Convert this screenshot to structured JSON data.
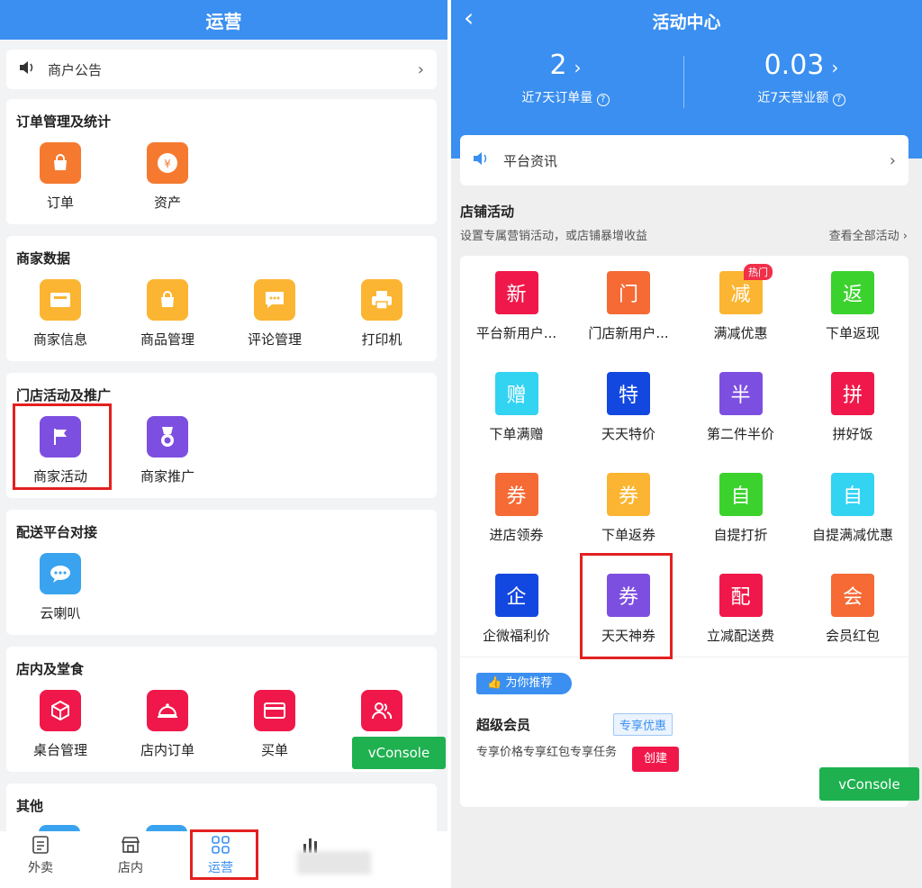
{
  "left": {
    "title": "运营",
    "notice": "商户公告",
    "sections": [
      {
        "title": "订单管理及统计",
        "items": [
          {
            "label": "订单",
            "icon": "bag-icon",
            "color": "#f57a30"
          },
          {
            "label": "资产",
            "icon": "yuan-coin-icon",
            "color": "#f57a30"
          }
        ]
      },
      {
        "title": "商家数据",
        "items": [
          {
            "label": "商家信息",
            "icon": "shop-info-icon",
            "color": "#fbb532"
          },
          {
            "label": "商品管理",
            "icon": "shopping-bag-icon",
            "color": "#fbb532"
          },
          {
            "label": "评论管理",
            "icon": "comment-icon",
            "color": "#fbb532"
          },
          {
            "label": "打印机",
            "icon": "printer-icon",
            "color": "#fbb532"
          }
        ]
      },
      {
        "title": "门店活动及推广",
        "items": [
          {
            "label": "商家活动",
            "icon": "flag-icon",
            "color": "#7d4fe0"
          },
          {
            "label": "商家推广",
            "icon": "medal-icon",
            "color": "#7d4fe0"
          }
        ]
      },
      {
        "title": "配送平台对接",
        "items": [
          {
            "label": "云喇叭",
            "icon": "chat-cloud-icon",
            "color": "#3aa3ef"
          }
        ]
      },
      {
        "title": "店内及堂食",
        "items": [
          {
            "label": "桌台管理",
            "icon": "cube-icon",
            "color": "#f0184a"
          },
          {
            "label": "店内订单",
            "icon": "bell-tray-icon",
            "color": "#f0184a"
          },
          {
            "label": "买单",
            "icon": "card-icon",
            "color": "#f0184a"
          },
          {
            "label": "",
            "icon": "users-icon",
            "color": "#f0184a"
          }
        ]
      },
      {
        "title": "其他",
        "items": []
      }
    ],
    "vconsole": "vConsole",
    "tabs": [
      {
        "label": "外卖",
        "icon": "list-icon"
      },
      {
        "label": "店内",
        "icon": "store-icon"
      },
      {
        "label": "运营",
        "icon": "grid-icon"
      },
      {
        "label": "",
        "icon": "bar-chart-icon"
      }
    ]
  },
  "right": {
    "title": "活动中心",
    "stats": [
      {
        "value": "2",
        "caption": "近7天订单量"
      },
      {
        "value": "0.03",
        "caption": "近7天营业额"
      }
    ],
    "notice": "平台资讯",
    "section_title": "店铺活动",
    "section_sub": "设置专属营销活动，或店铺暴增收益",
    "view_all": "查看全部活动",
    "activities": [
      {
        "char": "新",
        "label": "平台新用户...",
        "color": "#f0184a"
      },
      {
        "char": "门",
        "label": "门店新用户...",
        "color": "#f56a35"
      },
      {
        "char": "减",
        "label": "满减优惠",
        "color": "#fbb532",
        "badge": "热门"
      },
      {
        "char": "返",
        "label": "下单返现",
        "color": "#3bd22e"
      },
      {
        "char": "赠",
        "label": "下单满赠",
        "color": "#33d3f2"
      },
      {
        "char": "特",
        "label": "天天特价",
        "color": "#1348e0"
      },
      {
        "char": "半",
        "label": "第二件半价",
        "color": "#7d4fe0"
      },
      {
        "char": "拼",
        "label": "拼好饭",
        "color": "#f0184a"
      },
      {
        "char": "券",
        "label": "进店领券",
        "color": "#f56a35"
      },
      {
        "char": "券",
        "label": "下单返券",
        "color": "#fbb532"
      },
      {
        "char": "自",
        "label": "自提打折",
        "color": "#3bd22e"
      },
      {
        "char": "自",
        "label": "自提满减优惠",
        "color": "#33d3f2"
      },
      {
        "char": "企",
        "label": "企微福利价",
        "color": "#1348e0"
      },
      {
        "char": "券",
        "label": "天天神券",
        "color": "#7d4fe0"
      },
      {
        "char": "配",
        "label": "立减配送费",
        "color": "#f0184a"
      },
      {
        "char": "会",
        "label": "会员红包",
        "color": "#f56a35"
      }
    ],
    "recommend_tag": "为你推荐",
    "member_title": "超级会员",
    "member_badge": "专享优惠",
    "member_desc": "专享价格专享红包专享任务",
    "create_button": "创建",
    "vconsole": "vConsole"
  }
}
